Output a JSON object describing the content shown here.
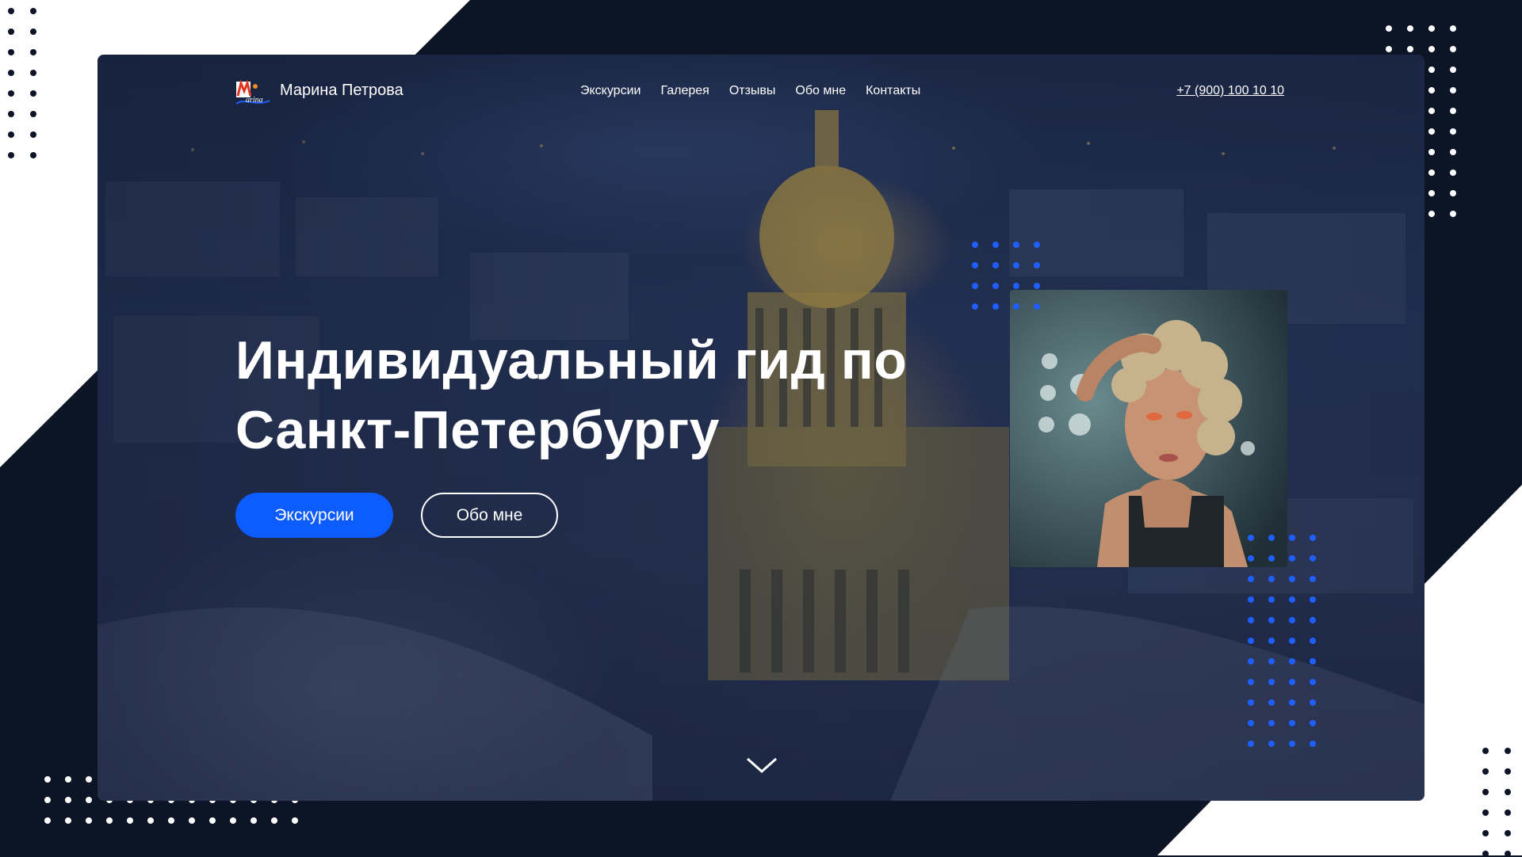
{
  "header": {
    "brand_name": "Марина Петрова",
    "logo_icon": "marina-logo-icon",
    "nav": [
      {
        "label": "Экскурсии"
      },
      {
        "label": "Галерея"
      },
      {
        "label": "Отзывы"
      },
      {
        "label": "Обо мне"
      },
      {
        "label": "Контакты"
      }
    ],
    "phone": "+7 (900) 100 10 10"
  },
  "hero": {
    "title_line1": "Индивидуальный гид по",
    "title_line2": "Санкт-Петербургу",
    "primary_button": "Экскурсии",
    "secondary_button": "Обо мне",
    "scroll_icon": "chevron-down-icon"
  },
  "colors": {
    "page_background": "#0c1526",
    "accent_blue": "#0c5cff",
    "dot_blue": "#1f5fff",
    "text": "#ffffff"
  }
}
